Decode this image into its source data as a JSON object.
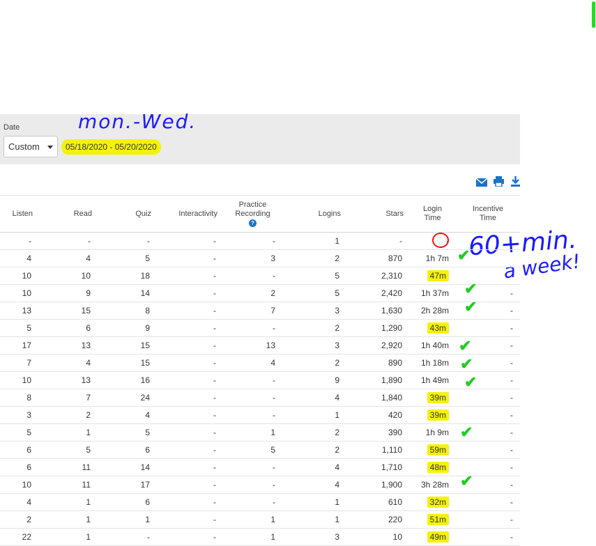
{
  "filter": {
    "date_label": "Date",
    "date_mode": "Custom",
    "date_range": "05/18/2020 - 05/20/2020"
  },
  "annotations": {
    "top_note": "mon.-Wed.",
    "goal_line1": "60+min.",
    "goal_line2": "a week!"
  },
  "toolbar": {
    "icons": [
      "email-icon",
      "print-icon",
      "download-icon"
    ]
  },
  "table": {
    "headers": [
      "Listen",
      "Read",
      "Quiz",
      "Interactivity",
      "Practice Recording",
      "Logins",
      "Stars",
      "Login Time",
      "Incentive Time"
    ],
    "rows": [
      [
        "-",
        "-",
        "-",
        "-",
        "-",
        "1",
        "-",
        "-",
        ""
      ],
      [
        "4",
        "4",
        "5",
        "-",
        "3",
        "2",
        "870",
        "1h 7m",
        ""
      ],
      [
        "10",
        "10",
        "18",
        "-",
        "-",
        "5",
        "2,310",
        "47m",
        ""
      ],
      [
        "10",
        "9",
        "14",
        "-",
        "2",
        "5",
        "2,420",
        "1h 37m",
        "-"
      ],
      [
        "13",
        "15",
        "8",
        "-",
        "7",
        "3",
        "1,630",
        "2h 28m",
        "-"
      ],
      [
        "5",
        "6",
        "9",
        "-",
        "-",
        "2",
        "1,290",
        "43m",
        "-"
      ],
      [
        "17",
        "13",
        "15",
        "-",
        "13",
        "3",
        "2,920",
        "1h 40m",
        "-"
      ],
      [
        "7",
        "4",
        "15",
        "-",
        "4",
        "2",
        "890",
        "1h 18m",
        "-"
      ],
      [
        "10",
        "13",
        "16",
        "-",
        "-",
        "9",
        "1,890",
        "1h 49m",
        "-"
      ],
      [
        "8",
        "7",
        "24",
        "-",
        "-",
        "4",
        "1,840",
        "39m",
        "-"
      ],
      [
        "3",
        "2",
        "4",
        "-",
        "-",
        "1",
        "420",
        "39m",
        "-"
      ],
      [
        "5",
        "1",
        "5",
        "-",
        "1",
        "2",
        "390",
        "1h 9m",
        "-"
      ],
      [
        "6",
        "5",
        "6",
        "-",
        "5",
        "2",
        "1,110",
        "59m",
        "-"
      ],
      [
        "6",
        "11",
        "14",
        "-",
        "-",
        "4",
        "1,710",
        "48m",
        "-"
      ],
      [
        "10",
        "11",
        "17",
        "-",
        "-",
        "4",
        "1,900",
        "3h 28m",
        "-"
      ],
      [
        "4",
        "1",
        "6",
        "-",
        "-",
        "1",
        "610",
        "32m",
        "-"
      ],
      [
        "2",
        "1",
        "1",
        "-",
        "1",
        "1",
        "220",
        "51m",
        "-"
      ],
      [
        "22",
        "1",
        "-",
        "-",
        "1",
        "3",
        "10",
        "49m",
        "-"
      ]
    ],
    "highlighted_login_rows": [
      2,
      5,
      9,
      10,
      12,
      13,
      15,
      16,
      17
    ]
  },
  "colors": {
    "highlight": "#f5f20a",
    "annotation_ink": "#1a1aff",
    "check": "#22cc22",
    "circle": "#ee1111"
  }
}
